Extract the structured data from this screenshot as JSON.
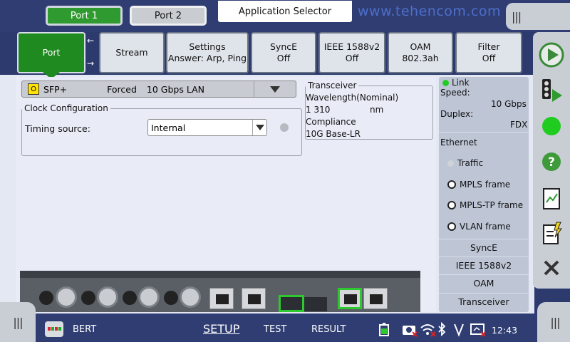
{
  "top": {
    "port1_label": "Port 1",
    "port2_label": "Port 2",
    "app_selector_label": "Application Selector",
    "brand_text": "www.tehencom.com"
  },
  "tabs": [
    {
      "title": "Port",
      "sub": ""
    },
    {
      "title": "Stream",
      "sub": ""
    },
    {
      "title": "Settings",
      "sub": "Answer: Arp, Ping"
    },
    {
      "title": "SyncE",
      "sub": "Off"
    },
    {
      "title": "IEEE 1588v2",
      "sub": "Off"
    },
    {
      "title": "OAM",
      "sub": "802.3ah"
    },
    {
      "title": "Filter",
      "sub": "Off"
    }
  ],
  "sfp": {
    "badge": "O",
    "interface": "SFP+",
    "mode": "Forced",
    "speed": "10 Gbps LAN"
  },
  "clock": {
    "legend": "Clock Configuration",
    "timing_label": "Timing source:",
    "timing_value": "Internal"
  },
  "transceiver": {
    "legend": "Transceiver",
    "line1": "Wavelength(Nominal)",
    "wavelength": "1 310",
    "unit": "nm",
    "line3": "Compliance",
    "line4": "10G Base-LR"
  },
  "status": {
    "link_label": "Link",
    "speed_label": "Speed:",
    "speed_value": "10 Gbps",
    "duplex_label": "Duplex:",
    "duplex_value": "FDX",
    "ethernet_label": "Ethernet",
    "traffic_label": "Traffic",
    "mpls_label": "MPLS frame",
    "mplstp_label": "MPLS-TP frame",
    "vlan_label": "VLAN frame",
    "rows": [
      "SyncE",
      "IEEE 1588v2",
      "OAM",
      "Transceiver"
    ]
  },
  "bottom": {
    "app_name": "BERT",
    "setup": "SETUP",
    "test": "TEST",
    "result": "RESULT",
    "time": "12:43"
  },
  "colors": {
    "accent_green": "#1f8a1f",
    "bar_blue": "#2f3d73",
    "panel_bg": "#e4e8f2"
  }
}
